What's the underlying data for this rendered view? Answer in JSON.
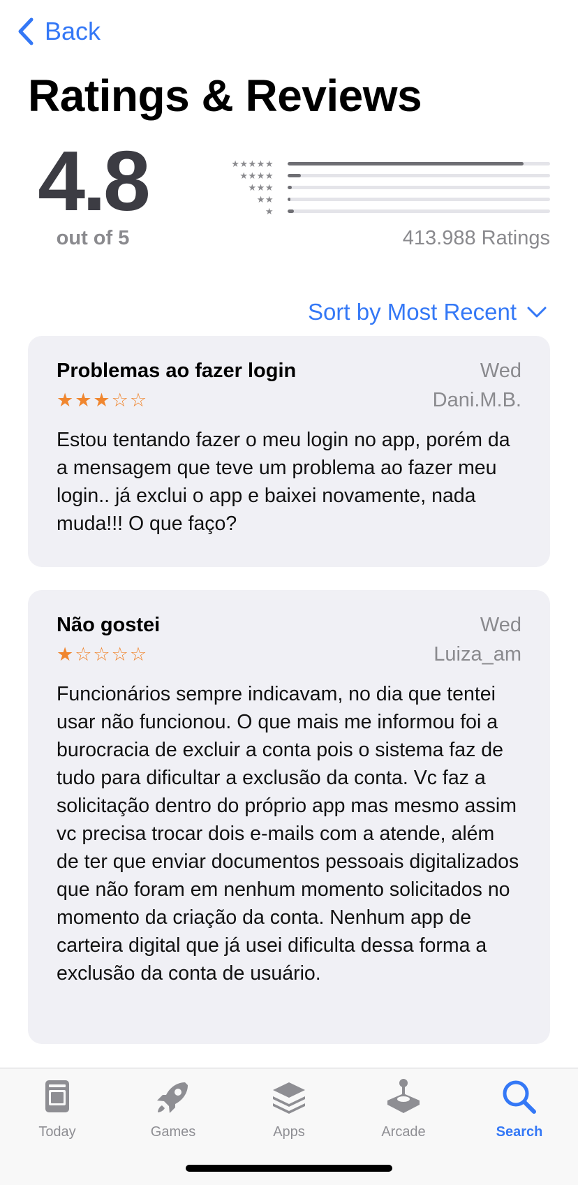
{
  "nav": {
    "back_label": "Back"
  },
  "page_title": "Ratings & Reviews",
  "summary": {
    "average": "4.8",
    "out_of": "out of 5",
    "ratings_count": "413.988 Ratings",
    "histogram": [
      {
        "stars": "★★★★★",
        "fraction": 0.9
      },
      {
        "stars": "★★★★",
        "fraction": 0.05
      },
      {
        "stars": "★★★",
        "fraction": 0.015
      },
      {
        "stars": "★★",
        "fraction": 0.01
      },
      {
        "stars": "★",
        "fraction": 0.025
      }
    ]
  },
  "sort": {
    "label": "Sort by Most Recent"
  },
  "reviews": [
    {
      "title": "Problemas ao fazer login",
      "date": "Wed",
      "author": "Dani.M.B.",
      "rating": 3,
      "stars": "★★★☆☆",
      "body": "Estou tentando fazer o meu login no app, porém da a mensagem que teve um problema ao fazer meu login.. já exclui o app e baixei novamente, nada muda!!! O que faço?"
    },
    {
      "title": "Não gostei",
      "date": "Wed",
      "author": "Luiza_am",
      "rating": 1,
      "stars": "★☆☆☆☆",
      "body": "Funcionários sempre indicavam, no dia que tentei usar não funcionou. O que mais me informou foi a burocracia de excluir a conta pois o sistema faz de tudo para dificultar a exclusão da conta. Vc faz a solicitação dentro do próprio app mas mesmo assim vc precisa trocar dois e-mails com a atende, além de ter que enviar documentos pessoais digitalizados que não foram em nenhum momento solicitados no momento da criação da conta. Nenhum app de carteira digital que já usei dificulta dessa forma a exclusão da conta de usuário."
    }
  ],
  "tabbar": {
    "tabs": [
      {
        "label": "Today",
        "icon": "today-icon",
        "active": false
      },
      {
        "label": "Games",
        "icon": "rocket-icon",
        "active": false
      },
      {
        "label": "Apps",
        "icon": "layers-icon",
        "active": false
      },
      {
        "label": "Arcade",
        "icon": "joystick-icon",
        "active": false
      },
      {
        "label": "Search",
        "icon": "search-icon",
        "active": true
      }
    ]
  },
  "colors": {
    "accent": "#3478f6",
    "star": "#f0862f",
    "card_bg": "#f0f0f5",
    "secondary_text": "#8a8a8e"
  }
}
